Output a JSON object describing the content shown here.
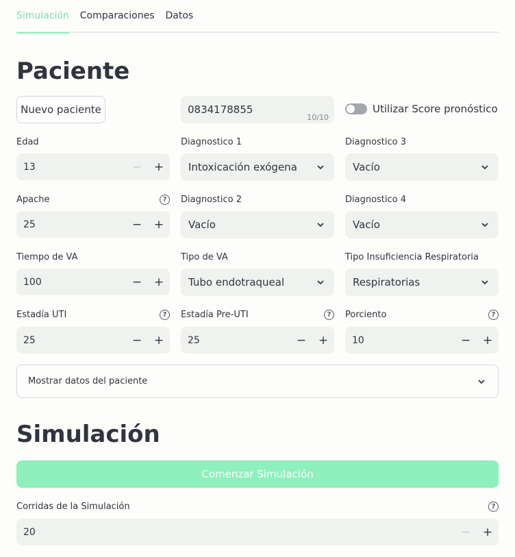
{
  "tabs": [
    {
      "label": "Simulación"
    },
    {
      "label": "Comparaciones"
    },
    {
      "label": "Datos"
    }
  ],
  "patient": {
    "title": "Paciente",
    "new_button": "Nuevo paciente",
    "id_value": "0834178855",
    "id_counter": "10/10",
    "toggle_label": "Utilizar Score pronóstico",
    "fields": {
      "edad": {
        "label": "Edad",
        "value": "13"
      },
      "apache": {
        "label": "Apache",
        "value": "25"
      },
      "tiempo_va": {
        "label": "Tiempo de VA",
        "value": "100"
      },
      "estadia_uti": {
        "label": "Estadía UTI",
        "value": "25"
      },
      "estadia_pre_uti": {
        "label": "Estadía Pre-UTI",
        "value": "25"
      },
      "porciento": {
        "label": "Porciento",
        "value": "10"
      },
      "diag1": {
        "label": "Diagnostico 1",
        "value": "Intoxicación exógena"
      },
      "diag2": {
        "label": "Diagnostico 2",
        "value": "Vacío"
      },
      "diag3": {
        "label": "Diagnostico 3",
        "value": "Vacío"
      },
      "diag4": {
        "label": "Diagnostico 4",
        "value": "Vacío"
      },
      "tipo_va": {
        "label": "Tipo de VA",
        "value": "Tubo endotraqueal"
      },
      "tipo_ir": {
        "label": "Tipo Insuficiencia Respiratoria",
        "value": "Respiratorias"
      }
    },
    "expander_label": "Mostrar datos del paciente"
  },
  "simulation": {
    "title": "Simulación",
    "start_button": "Comenzar Simulación",
    "runs_label": "Corridas de la Simulación",
    "runs_value": "20"
  },
  "colors": {
    "accent": "#8df0bd",
    "input_bg": "#f0f2f0",
    "text": "#31333f"
  }
}
